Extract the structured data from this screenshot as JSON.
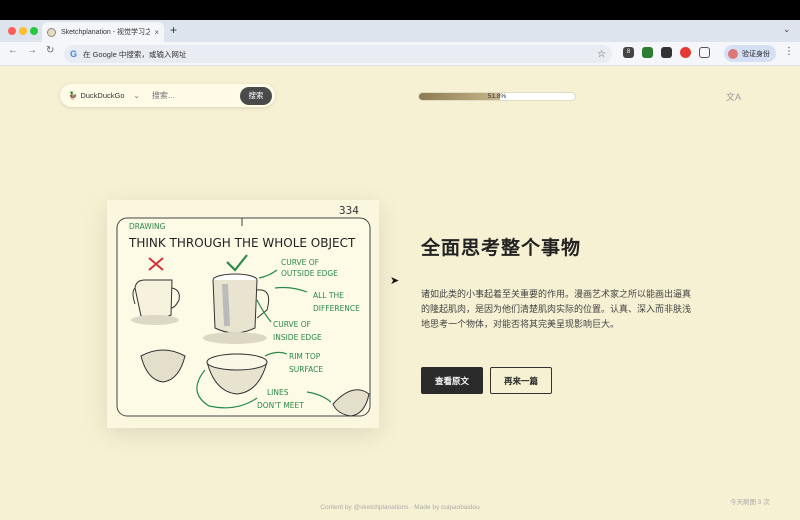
{
  "browser": {
    "tab_title": "Sketchplanation - 视觉学习之",
    "tab_close": "×",
    "new_tab": "+",
    "address_text": "在 Google 中搜索，或输入网址",
    "profile_label": "验证身份",
    "ext_badge": "8"
  },
  "search": {
    "engine": "DuckDuckGo",
    "placeholder": "搜索...",
    "button": "搜索"
  },
  "progress": {
    "label": "51.8%",
    "fraction": 0.518
  },
  "sketch": {
    "number": "334",
    "category": "DRAWING",
    "heading": "THINK THROUGH THE WHOLE OBJECT",
    "annotations": {
      "curve_outside": [
        "CURVE OF",
        "OUTSIDE EDGE"
      ],
      "all_difference": [
        "ALL THE",
        "DIFFERENCE"
      ],
      "curve_inside": [
        "CURVE OF",
        "INSIDE EDGE"
      ],
      "rim_top": [
        "RIM TOP",
        "SURFACE"
      ],
      "lines": [
        "LINES",
        "DON'T MEET"
      ]
    }
  },
  "article": {
    "title": "全面思考整个事物",
    "description": "诸如此类的小事起着至关重要的作用。漫画艺术家之所以能画出逼真的隆起肌肉，是因为他们清楚肌肉实际的位置。认真、深入而非肤浅地思考一个物体，对能否将其完美呈现影响巨大。",
    "view_button": "查看原文",
    "next_button": "再来一篇"
  },
  "footer": {
    "credit": "Content by @sketchplanations · Made by cuipaobaidou",
    "views": "今天刷图 3 次"
  },
  "colors": {
    "accent_green": "#2a8a4a",
    "cross_red": "#d0323c",
    "page_bg": "#f6f1d3"
  },
  "icons": [
    "back-icon",
    "forward-icon",
    "reload-icon",
    "star-icon",
    "translate-icon",
    "chevron-down-icon"
  ]
}
